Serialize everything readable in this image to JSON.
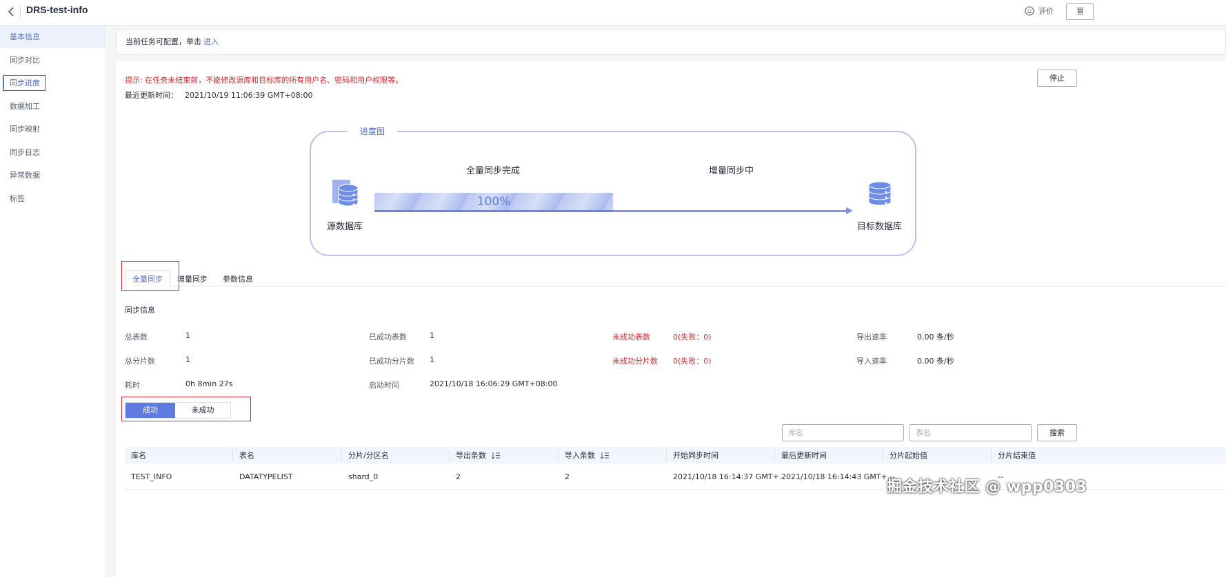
{
  "header": {
    "title": "DRS-test-info",
    "rate_label": "评价",
    "right_btn": "亘"
  },
  "sidebar": {
    "items": [
      {
        "label": "基本信息"
      },
      {
        "label": "同步对比"
      },
      {
        "label": "同步进度"
      },
      {
        "label": "数据加工"
      },
      {
        "label": "同步映射"
      },
      {
        "label": "同步日志"
      },
      {
        "label": "异常数据"
      },
      {
        "label": "标签"
      }
    ]
  },
  "notice": {
    "text": "当前任务可配置，单击",
    "link": "进入"
  },
  "tip": "提示: 在任务未结束前，不能修改源库和目标库的所有用户名、密码和用户权限等。",
  "updated": {
    "label": "最近更新时间：",
    "value": "2021/10/19 11:06:39 GMT+08:00"
  },
  "stop_label": "停止",
  "progress": {
    "title": "进度图",
    "stage_full": "全量同步完成",
    "stage_incr": "增量同步中",
    "percent_text": "100%",
    "percent": 1.0,
    "source_label": "源数据库",
    "target_label": "目标数据库"
  },
  "tabs": [
    {
      "label": "全量同步"
    },
    {
      "label": "增量同步"
    },
    {
      "label": "参数信息"
    }
  ],
  "sync_info": {
    "title": "同步信息",
    "stats": {
      "total_tables": {
        "label": "总表数",
        "value": "1"
      },
      "success_tables": {
        "label": "已成功表数",
        "value": "1"
      },
      "failed_tables": {
        "label": "未成功表数",
        "value": "0(失败：0)"
      },
      "export_rate": {
        "label": "导出速率",
        "value": "0.00 条/秒"
      },
      "total_shards": {
        "label": "总分片数",
        "value": "1"
      },
      "success_shards": {
        "label": "已成功分片数",
        "value": "1"
      },
      "failed_shards": {
        "label": "未成功分片数",
        "value": "0(失败：0)"
      },
      "import_rate": {
        "label": "导入速率",
        "value": "0.00 条/秒"
      },
      "elapsed": {
        "label": "耗时",
        "value": "0h 8min 27s"
      },
      "start_time": {
        "label": "启动时间",
        "value": "2021/10/18 16:06:29 GMT+08:00"
      }
    }
  },
  "segment": {
    "on_label": "成功",
    "off_label": "未成功"
  },
  "search": {
    "db_placeholder": "库名",
    "table_placeholder": "表名",
    "button": "搜索"
  },
  "table": {
    "columns": [
      "库名",
      "表名",
      "分片/分区名",
      "导出条数",
      "导入条数",
      "开始同步时间",
      "最后更新时间",
      "分片起始值",
      "分片结束值"
    ],
    "rows": [
      [
        "TEST_INFO",
        "DATATYPELIST",
        "shard_0",
        "2",
        "2",
        "2021/10/18 16:14:37 GMT+...",
        "2021/10/18 16:14:43 GMT+...",
        "--",
        "--"
      ]
    ]
  },
  "watermark": "掘金技术社区 @ wpp0303",
  "colors": {
    "accent": "#526ecc",
    "danger": "#d7262c",
    "progress_fill": "#bcc9f2"
  }
}
